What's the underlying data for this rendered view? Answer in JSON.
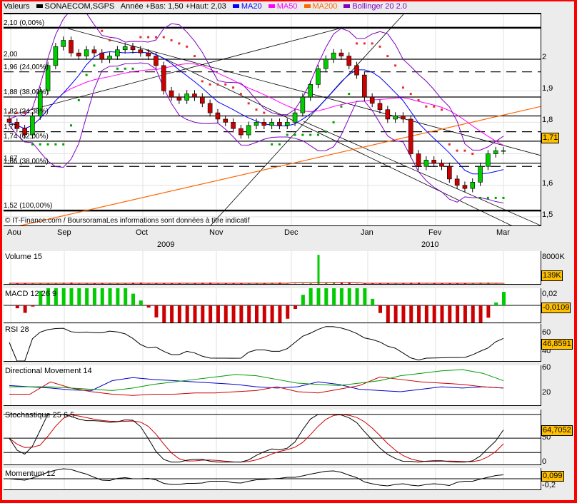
{
  "header": {
    "label": "Valeurs",
    "symbol": "SONAECOM,SGPS",
    "range": "Année +Bas: 1,50 +Haut: 2,03",
    "legend": [
      {
        "name": "MA20",
        "color": "#0000ff"
      },
      {
        "name": "MA50",
        "color": "#ff00ff"
      },
      {
        "name": "MA200",
        "color": "#ff6600"
      },
      {
        "name": "Bollinger 20 2.0",
        "color": "#8000c0"
      }
    ]
  },
  "credit": "© IT-Finance.com / BoursoramaLes informations sont données à titre indicatif",
  "months": [
    "Aou",
    "Sep",
    "Oct",
    "Nov",
    "Dec",
    "Jan",
    "Fev",
    "Mar"
  ],
  "years": [
    "2009",
    "2010"
  ],
  "chart_data": {
    "type": "candlestick",
    "ylim": [
      1.45,
      2.12
    ],
    "yticks": [
      "2",
      "1,9",
      "1,8",
      "1,6",
      "1,5"
    ],
    "last_price": "1,71",
    "closes": [
      1.8,
      1.78,
      1.76,
      1.82,
      1.9,
      1.98,
      2.04,
      2.06,
      2.02,
      2.01,
      2.03,
      2.02,
      2.0,
      2.01,
      2.03,
      2.04,
      2.03,
      2.02,
      2.01,
      1.98,
      1.9,
      1.88,
      1.87,
      1.89,
      1.88,
      1.86,
      1.83,
      1.81,
      1.8,
      1.78,
      1.76,
      1.79,
      1.8,
      1.79,
      1.8,
      1.79,
      1.8,
      1.83,
      1.88,
      1.92,
      1.97,
      2.0,
      2.02,
      2.01,
      1.98,
      1.95,
      1.88,
      1.86,
      1.84,
      1.81,
      1.82,
      1.81,
      1.7,
      1.66,
      1.68,
      1.67,
      1.66,
      1.62,
      1.6,
      1.59,
      1.61,
      1.66,
      1.7,
      1.71,
      1.71
    ],
    "ma200": [
      1.46,
      1.85
    ],
    "levels": [
      {
        "v": 2.1,
        "label": "2,10 (0,00%)"
      },
      {
        "v": 2.0,
        "label": "2,00"
      },
      {
        "v": 1.96,
        "label": "1,96 (24,00%)"
      },
      {
        "v": 1.88,
        "label": "1,88 (38,00%)"
      },
      {
        "v": 1.82,
        "label": "1,82 (24,38%)"
      },
      {
        "v": 1.77,
        "label": "1,77"
      },
      {
        "v": 1.74,
        "label": "1,74 (62,00%)"
      },
      {
        "v": 1.67,
        "label": "1,67"
      },
      {
        "v": 1.66,
        "label": "1,66 (38,00%)"
      },
      {
        "v": 1.52,
        "label": "1,52 (100,00%)"
      }
    ],
    "indicators": {
      "volume": {
        "title": "Volume 15",
        "ticks": [
          "8000K"
        ],
        "last": "139K"
      },
      "macd": {
        "title": "MACD 12 26 9",
        "ticks": [
          "0,02"
        ],
        "last": "-0,0109"
      },
      "rsi": {
        "title": "RSI 28",
        "ticks": [
          "60",
          "40"
        ],
        "last": "46,8591"
      },
      "dm": {
        "title": "Directional Movement 14",
        "ticks": [
          "60",
          "20"
        ],
        "plus": [
          32,
          30,
          28,
          25,
          24,
          40,
          45,
          42,
          40,
          38,
          36,
          34,
          30,
          28,
          30,
          38,
          34,
          26,
          24,
          22,
          26,
          30,
          28,
          30,
          28
        ],
        "minus": [
          18,
          18,
          38,
          28,
          22,
          18,
          16,
          18,
          18,
          20,
          20,
          22,
          24,
          30,
          22,
          20,
          26,
          32,
          46,
          42,
          38,
          36,
          34,
          30,
          28
        ],
        "adx": [
          30,
          30,
          30,
          28,
          26,
          24,
          28,
          34,
          38,
          42,
          46,
          50,
          48,
          42,
          36,
          34,
          32,
          36,
          40,
          48,
          52,
          56,
          58,
          52,
          40
        ]
      },
      "stoch": {
        "title": "Stochastique 25 6 5",
        "ticks": [
          "50",
          "0"
        ],
        "last": "64,7052"
      },
      "momentum": {
        "title": "Momentum 12",
        "ticks": [
          "-0,2"
        ],
        "last": "0,099"
      }
    }
  }
}
